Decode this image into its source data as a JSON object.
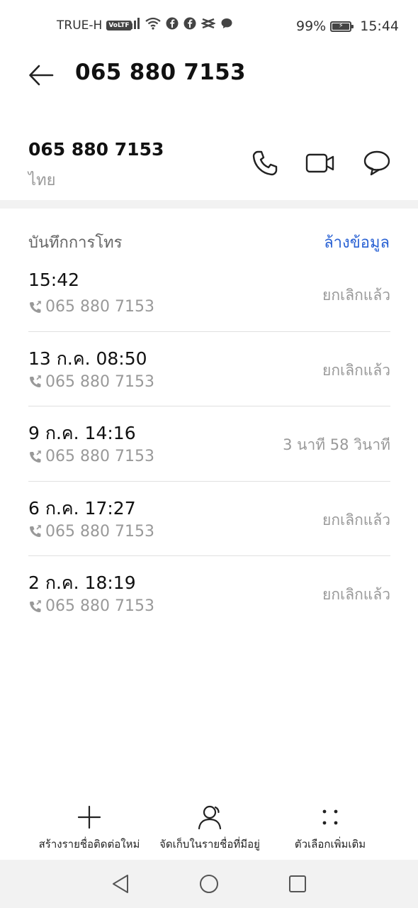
{
  "status_bar": {
    "carrier": "TRUE-H",
    "volte": "VoLTE",
    "battery": "99%",
    "time": "15:44",
    "icons": [
      "signal-icon",
      "wifi-icon",
      "facebook-icon",
      "facebook-icon",
      "capcut-icon",
      "chat-icon"
    ]
  },
  "header": {
    "title": "065 880 7153"
  },
  "contact": {
    "number": "065 880 7153",
    "country": "ไทย"
  },
  "call_log": {
    "title": "บันทึกการโทร",
    "clear_label": "ล้างข้อมูล",
    "rows": [
      {
        "time": "15:42",
        "number": "065 880 7153",
        "status": "ยกเลิกแล้ว"
      },
      {
        "time": "13 ก.ค. 08:50",
        "number": "065 880 7153",
        "status": "ยกเลิกแล้ว"
      },
      {
        "time": "9 ก.ค. 14:16",
        "number": "065 880 7153",
        "status": "3 นาที 58 วินาที"
      },
      {
        "time": "6 ก.ค. 17:27",
        "number": "065 880 7153",
        "status": "ยกเลิกแล้ว"
      },
      {
        "time": "2 ก.ค. 18:19",
        "number": "065 880 7153",
        "status": "ยกเลิกแล้ว"
      }
    ]
  },
  "toolbar": {
    "new_contact": "สร้างรายชื่อติดต่อใหม่",
    "save_existing": "จัดเก็บในรายชื่อที่มีอยู่",
    "more_options": "ตัวเลือกเพิ่มเติม"
  },
  "colors": {
    "accent": "#2a62d4",
    "muted_text": "#999999"
  }
}
